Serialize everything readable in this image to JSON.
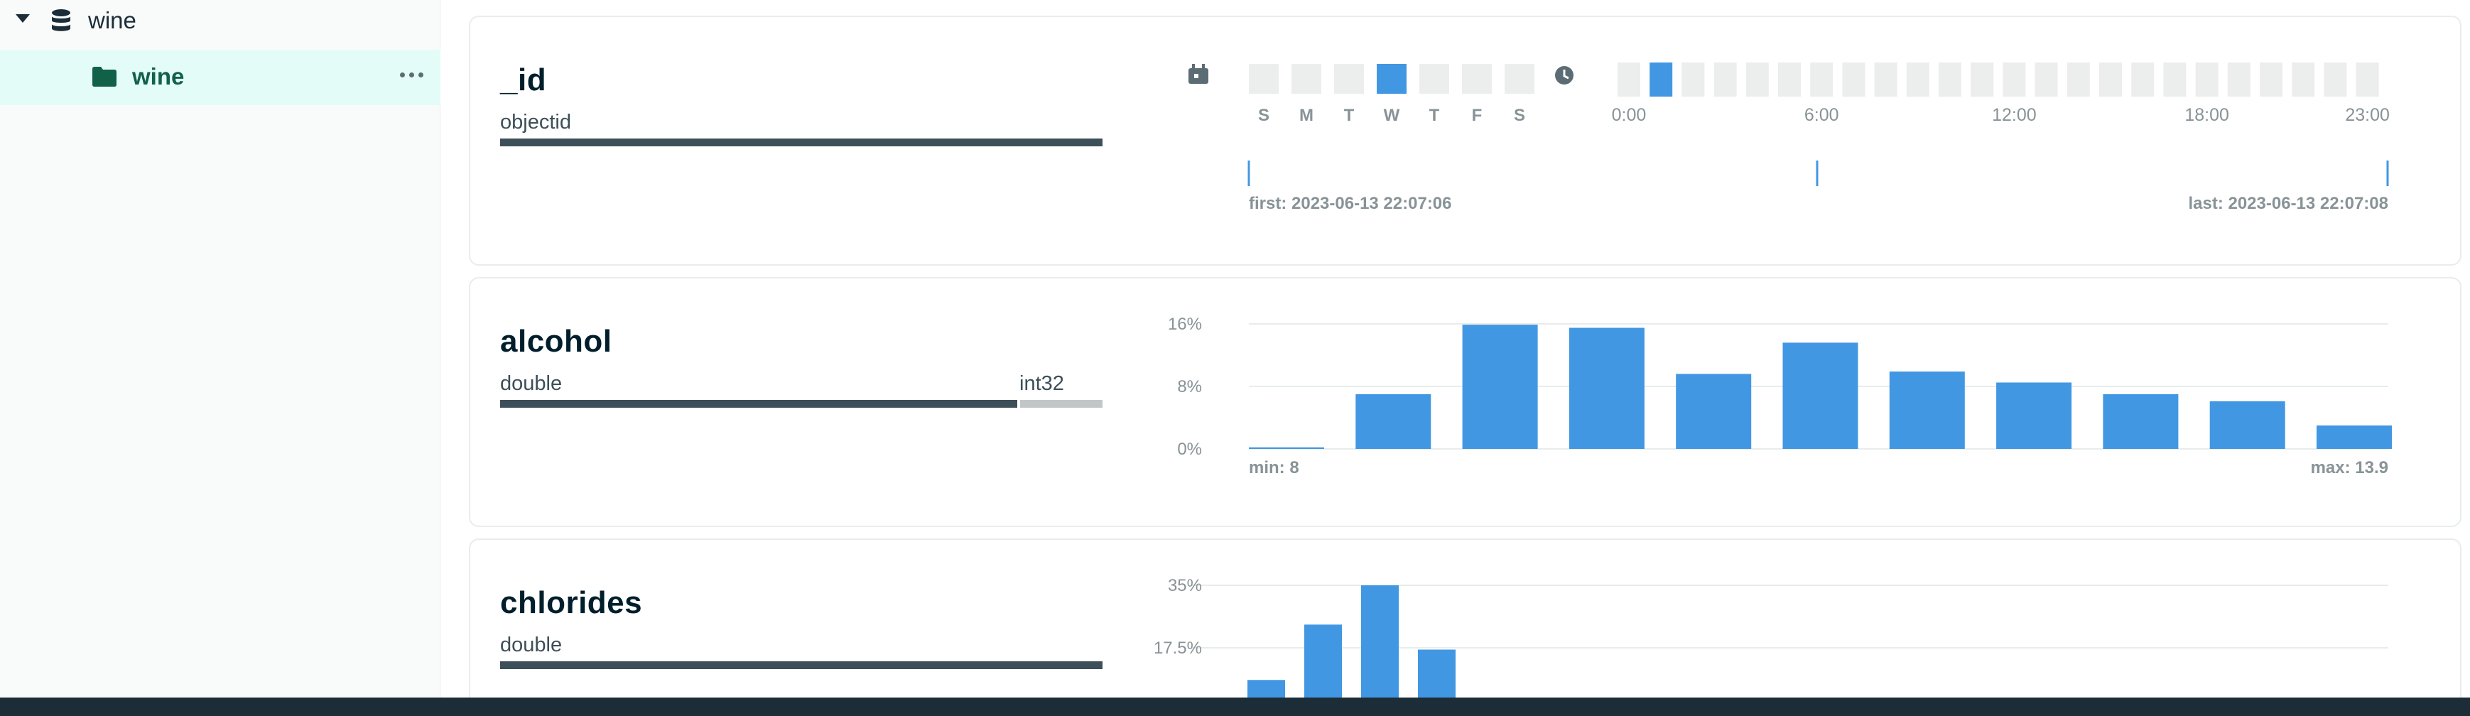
{
  "sidebar": {
    "database": {
      "label": "wine",
      "icon": "database-icon"
    },
    "collection": {
      "label": "wine",
      "icon": "folder-icon",
      "more_icon": "ellipsis-icon"
    }
  },
  "fields": [
    {
      "name": "_id",
      "types": [
        {
          "label": "objectid",
          "share": 1.0
        }
      ],
      "weekday_icon": "calendar-icon",
      "hour_icon": "clock-icon",
      "weekdays": [
        "S",
        "M",
        "T",
        "W",
        "T",
        "F",
        "S"
      ],
      "weekday_highlight": 3,
      "hour_labels": [
        "0:00",
        "6:00",
        "12:00",
        "18:00",
        "23:00"
      ],
      "hour_highlight": 1,
      "hours": 24,
      "first": "first: 2023-06-13 22:07:06",
      "last": "last: 2023-06-13 22:07:08"
    },
    {
      "name": "alcohol",
      "types": [
        {
          "label": "double",
          "share": 0.86
        },
        {
          "label": "int32",
          "share": 0.14
        }
      ],
      "min_label": "min: 8",
      "max_label": "max: 13.9"
    },
    {
      "name": "chlorides",
      "types": [
        {
          "label": "double",
          "share": 1.0
        }
      ]
    }
  ],
  "chart_data": [
    {
      "type": "bar",
      "field": "alcohol",
      "values": [
        0.2,
        7.0,
        15.9,
        15.5,
        9.6,
        13.6,
        9.9,
        8.5,
        7.0,
        6.1,
        3.0
      ],
      "ylim": [
        0,
        16
      ],
      "y_ticks": [
        "0%",
        "8%",
        "16%"
      ],
      "y_tick_values": [
        0,
        8,
        16
      ],
      "grid": true
    },
    {
      "type": "bar",
      "field": "chlorides",
      "values": [
        0,
        8.5,
        24.0,
        35.0,
        17.0
      ],
      "ylim": [
        0,
        35
      ],
      "y_ticks": [
        "17.5%",
        "35%"
      ],
      "y_tick_values": [
        17.5,
        35
      ],
      "grid": true
    }
  ],
  "colors": {
    "bar": "#4297e3",
    "bar_light": "#ebeeed",
    "type_primary": "#3d4f58",
    "type_secondary": "#c1c7c6",
    "sidebar_active": "#e3fcf7",
    "active_text": "#116149"
  }
}
